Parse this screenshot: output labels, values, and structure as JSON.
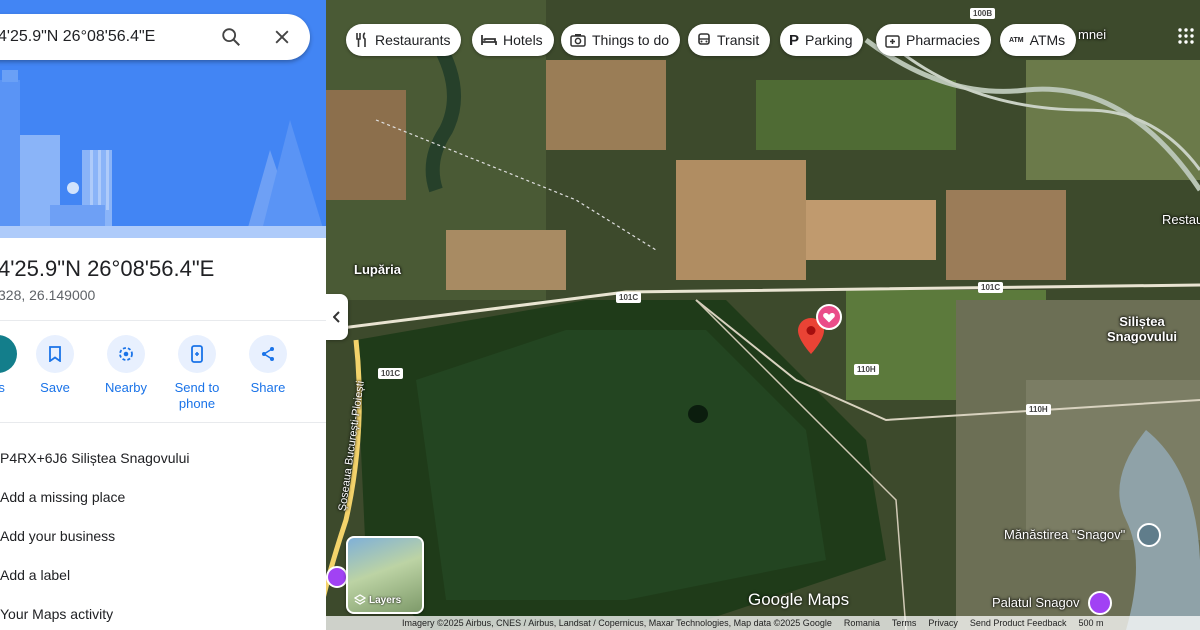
{
  "search": {
    "query": "4'25.9\"N 26°08'56.4\"E"
  },
  "place": {
    "title": "4'25.9\"N 26°08'56.4\"E",
    "decimal": "328, 26.149000"
  },
  "actions": [
    {
      "label": "ns",
      "icon": "directions-icon"
    },
    {
      "label": "Save",
      "icon": "bookmark-icon"
    },
    {
      "label": "Nearby",
      "icon": "nearby-icon"
    },
    {
      "label": "Send to phone",
      "icon": "send-to-phone-icon"
    },
    {
      "label": "Share",
      "icon": "share-icon"
    }
  ],
  "rows": [
    {
      "label": "P4RX+6J6 Siliștea Snagovului"
    },
    {
      "label": "Add a missing place"
    },
    {
      "label": "Add your business"
    },
    {
      "label": "Add a label"
    },
    {
      "label": "Your Maps activity"
    }
  ],
  "chips": [
    {
      "label": "Restaurants",
      "icon": "restaurant-icon"
    },
    {
      "label": "Hotels",
      "icon": "hotel-icon"
    },
    {
      "label": "Things to do",
      "icon": "camera-icon"
    },
    {
      "label": "Transit",
      "icon": "transit-icon"
    },
    {
      "label": "Parking",
      "icon": "parking-icon"
    },
    {
      "label": "Pharmacies",
      "icon": "pharmacy-icon"
    },
    {
      "label": "ATMs",
      "icon": "atm-icon"
    }
  ],
  "map_labels": {
    "lupariia": "Lupăria",
    "silistea": "Siliștea Snagovului",
    "manastirea": "Mănăstirea \"Snagov\"",
    "palatul": "Palatul Snagov",
    "soseaua": "Șoseaua București-Ploiești",
    "restau": "Restaur",
    "mnei": "mnei"
  },
  "road_shields": [
    "100B",
    "101C",
    "101C",
    "101C",
    "110H",
    "110H"
  ],
  "layers_label": "Layers",
  "google_maps": "Google Maps",
  "footer": {
    "imagery": "Imagery ©2025 Airbus, CNES / Airbus, Landsat / Copernicus, Maxar Technologies, Map data ©2025 Google",
    "country": "Romania",
    "terms": "Terms",
    "privacy": "Privacy",
    "feedback": "Send Product Feedback",
    "scale": "500 m"
  },
  "colors": {
    "accent": "#1a73e8",
    "hero": "#4285f4",
    "pin": "#ea4335"
  }
}
